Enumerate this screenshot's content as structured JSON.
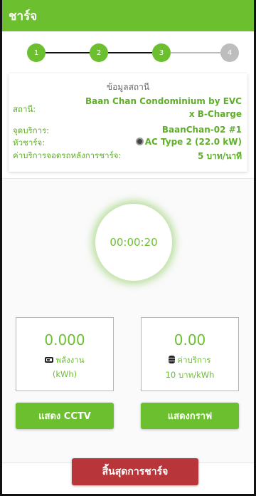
{
  "header": {
    "title": "ชาร์จ"
  },
  "stepper": {
    "steps": [
      {
        "label": "1",
        "status": "done"
      },
      {
        "label": "2",
        "status": "done"
      },
      {
        "label": "3",
        "status": "done"
      },
      {
        "label": "4",
        "status": "pending"
      }
    ]
  },
  "station_info": {
    "title": "ข้อมูลสถานี",
    "station_label": "สถานี:",
    "station_value_line1": "Baan Chan Condominium by EVC",
    "station_value_line2": "x B-Charge",
    "service_point_label": "จุดบริการ:",
    "service_point_value": "BaanChan-02 #1",
    "connector_label": "หัวชาร์จ:",
    "connector_value": "AC Type 2 (22.0 kW)",
    "parking_fee_label": "ค่าบริการจอดรถหลังการชาร์จ:",
    "parking_fee_value": "5 บาท/นาที"
  },
  "session": {
    "elapsed_time": "00:00:20",
    "energy": {
      "value": "0.000",
      "label": "พลังงาน",
      "unit": "(kWh)"
    },
    "cost": {
      "value": "0.00",
      "label": "ค่าบริการ",
      "rate": "10 บาท/kWh"
    }
  },
  "actions": {
    "cctv_label": "แสดง CCTV",
    "graph_label": "แสดงกราฟ",
    "end_label": "สิ้นสุดการชาร์จ"
  },
  "colors": {
    "primary": "#6cbf2f",
    "danger": "#b8363a",
    "step_pending": "#bdbdbd"
  }
}
